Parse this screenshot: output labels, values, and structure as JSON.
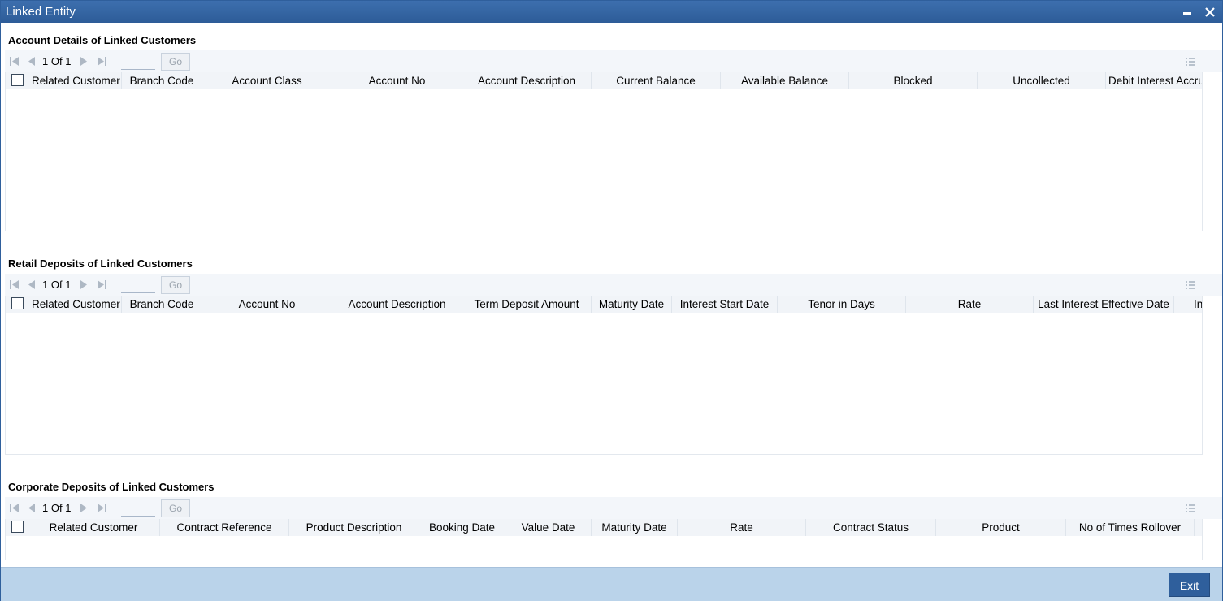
{
  "window": {
    "title": "Linked Entity"
  },
  "sections": [
    {
      "title": "Account Details of Linked Customers",
      "pager": {
        "current": "1",
        "of_label": "Of",
        "total": "1",
        "go": "Go"
      },
      "columns": [
        "Related Customer",
        "Branch Code",
        "Account Class",
        "Account No",
        "Account Description",
        "Current Balance",
        "Available Balance",
        "Blocked",
        "Uncollected",
        "Debit Interest Accru"
      ]
    },
    {
      "title": "Retail Deposits of Linked Customers",
      "pager": {
        "current": "1",
        "of_label": "Of",
        "total": "1",
        "go": "Go"
      },
      "columns": [
        "Related Customer",
        "Branch Code",
        "Account No",
        "Account Description",
        "Term Deposit Amount",
        "Maturity Date",
        "Interest Start Date",
        "Tenor in Days",
        "Rate",
        "Last Interest Effective Date",
        "In"
      ]
    },
    {
      "title": "Corporate Deposits of Linked Customers",
      "pager": {
        "current": "1",
        "of_label": "Of",
        "total": "1",
        "go": "Go"
      },
      "columns": [
        "Related Customer",
        "Contract Reference",
        "Product Description",
        "Booking Date",
        "Value Date",
        "Maturity Date",
        "Rate",
        "Contract Status",
        "Product",
        "No of Times Rollover"
      ]
    }
  ],
  "footer": {
    "exit_label": "Exit"
  }
}
